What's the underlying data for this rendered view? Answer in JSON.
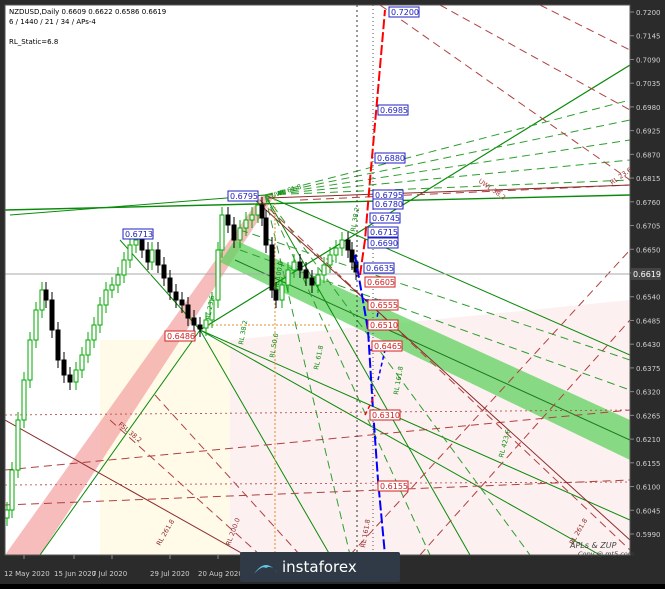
{
  "header": {
    "symbol_line": "NZDUSD,Daily  0.6609 0.6622 0.6586 0.6619",
    "params_line": "6 / 1440 / 21 / 34 / APs-4",
    "static_label": "RL_Static=6.8"
  },
  "chart_data": {
    "type": "candlestick",
    "title": "NZDUSD,Daily",
    "ohlc_last": {
      "open": 0.6609,
      "high": 0.6622,
      "low": 0.6586,
      "close": 0.6619
    },
    "current_price": "0.6619",
    "ylim": [
      0.599,
      0.7235
    ],
    "y_ticks": [
      "0.7200",
      "0.7145",
      "0.7090",
      "0.7035",
      "0.6980",
      "0.6925",
      "0.6870",
      "0.6815",
      "0.6760",
      "0.6705",
      "0.6650",
      "0.6595",
      "0.6540",
      "0.6485",
      "0.6430",
      "0.6375",
      "0.6320",
      "0.6265",
      "0.6210",
      "0.6155",
      "0.6100",
      "0.6045",
      "0.5990"
    ],
    "x_ticks": [
      "12 May 2020",
      "15 Jun 2020",
      "7 Jul 2020",
      "29 Jul 2020",
      "20 Aug 2020"
    ],
    "price_labels_blue": [
      "0.7200",
      "0.6985",
      "0.6880",
      "0.6795",
      "0.6713",
      "0.6795",
      "0.6780",
      "0.6745",
      "0.6715",
      "0.6690",
      "0.6635"
    ],
    "price_labels_red": [
      "0.6605",
      "0.6555",
      "0.6510",
      "0.6465",
      "0.6310",
      "0.6155",
      "0.6486"
    ],
    "level_annotations": [
      "UWL 61.8",
      "UWL 38.2",
      "RL 23.6",
      "RL 38.2",
      "RL 50.0",
      "RL 61.8",
      "RL 100.0",
      "RL 161.8",
      "RL 161.8",
      "RL 423.6",
      "RL 261.8",
      "FSL 38.2",
      "RL 261.8",
      "RL 200.0",
      "RL 38.2",
      "RL 23.6"
    ],
    "colors": {
      "bull": "#00aa00",
      "bear": "#000000",
      "up_projection": "#ff0000",
      "down_projection": "#0000ff",
      "channel_green": "#33cc33",
      "channel_pink": "#f4a5a5"
    }
  },
  "watermark": {
    "main": "APLs & ZUP",
    "sub": "Copy @ mt5.com"
  },
  "brand": {
    "name": "instaforex"
  }
}
